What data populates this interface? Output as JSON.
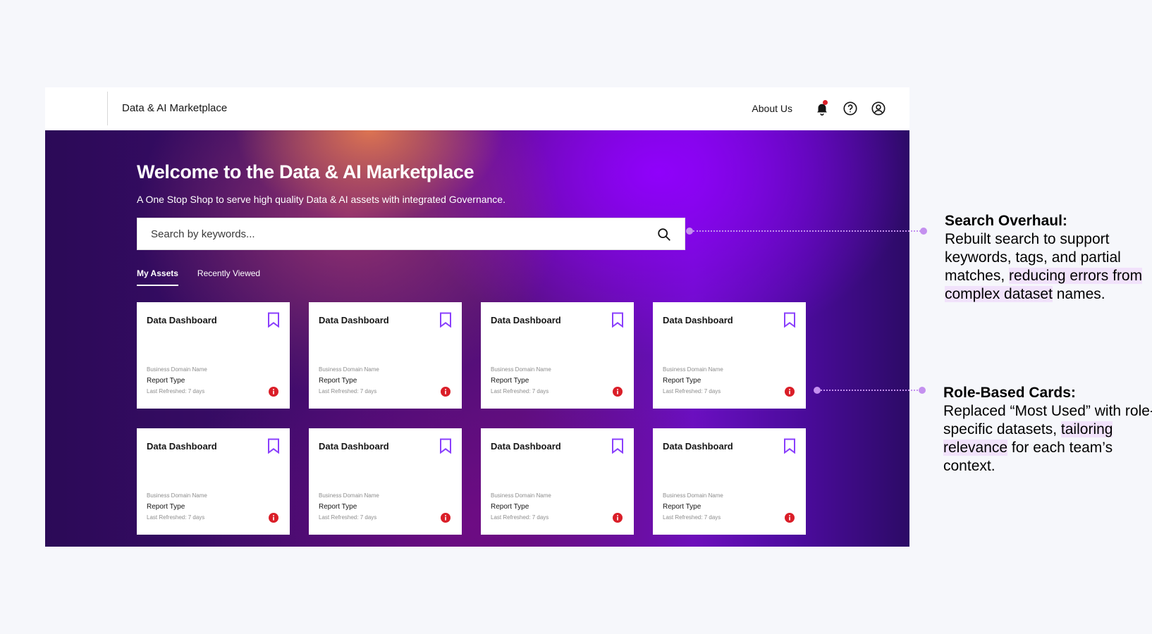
{
  "header": {
    "app_title": "Data & AI Marketplace",
    "about_label": "About Us",
    "icons": [
      "bell-icon",
      "help-icon",
      "user-icon"
    ]
  },
  "hero": {
    "title": "Welcome to the Data & AI Marketplace",
    "subtitle": "A One Stop Shop to serve high quality Data & AI assets with integrated Governance."
  },
  "search": {
    "placeholder": "Search by keywords..."
  },
  "tabs": [
    {
      "label": "My Assets",
      "active": true
    },
    {
      "label": "Recently Viewed",
      "active": false
    }
  ],
  "cards": [
    {
      "title": "Data Dashboard",
      "domain": "Business Domain Name",
      "type": "Report Type",
      "refreshed": "Last Refreshed: 7 days"
    },
    {
      "title": "Data Dashboard",
      "domain": "Business Domain Name",
      "type": "Report Type",
      "refreshed": "Last Refreshed: 7 days"
    },
    {
      "title": "Data Dashboard",
      "domain": "Business Domain Name",
      "type": "Report Type",
      "refreshed": "Last Refreshed: 7 days"
    },
    {
      "title": "Data Dashboard",
      "domain": "Business Domain Name",
      "type": "Report Type",
      "refreshed": "Last Refreshed: 7 days"
    },
    {
      "title": "Data Dashboard",
      "domain": "Business Domain Name",
      "type": "Report Type",
      "refreshed": "Last Refreshed: 7 days"
    },
    {
      "title": "Data Dashboard",
      "domain": "Business Domain Name",
      "type": "Report Type",
      "refreshed": "Last Refreshed: 7 days"
    },
    {
      "title": "Data Dashboard",
      "domain": "Business Domain Name",
      "type": "Report Type",
      "refreshed": "Last Refreshed: 7 days"
    },
    {
      "title": "Data Dashboard",
      "domain": "Business Domain Name",
      "type": "Report Type",
      "refreshed": "Last Refreshed: 7 days"
    }
  ],
  "annotations": {
    "search": {
      "heading": "Search Overhaul:",
      "text_before": "Rebuilt search to support keywords, tags, and partial matches, ",
      "highlight": "reducing errors from complex dataset",
      "text_after": " names."
    },
    "cards": {
      "heading": "Role-Based Cards:",
      "text_before": "Replaced “Most Used” with role-specific datasets, ",
      "highlight": "tailoring relevance",
      "text_after": " for each team’s context."
    }
  },
  "colors": {
    "accent": "#8a3ffc",
    "bookmark": "#8a3ffc",
    "info": "#da1e28",
    "notification": "#da1e28",
    "annotation": "#c490ef",
    "highlight": "#f1e2fb"
  }
}
